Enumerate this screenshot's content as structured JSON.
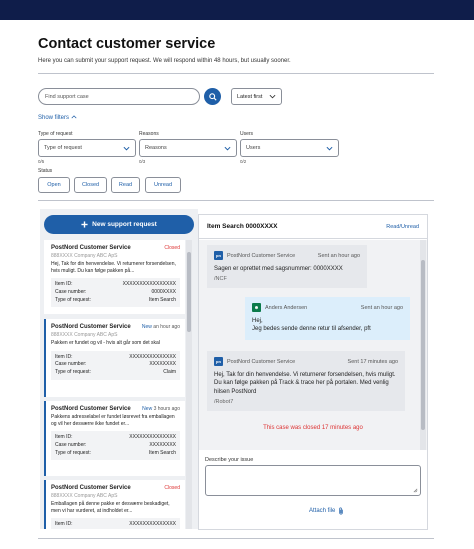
{
  "header": {
    "title": "Contact customer service",
    "subtitle": "Here you can submit your support request. We will respond within 48 hours, but usually sooner."
  },
  "search": {
    "placeholder": "Find support case",
    "button_icon": "search-icon"
  },
  "sort": {
    "selected": "Latest first"
  },
  "filters": {
    "toggle_label": "Show filters",
    "type": {
      "label": "Type of request",
      "placeholder": "Type of request",
      "count": "0/5"
    },
    "reasons": {
      "label": "Reasons",
      "placeholder": "Reasons",
      "count": "0/3"
    },
    "users": {
      "label": "Users",
      "placeholder": "Users",
      "count": "0/2"
    },
    "status": {
      "label": "Status",
      "buttons": [
        "Open",
        "Closed",
        "Read",
        "Unread"
      ]
    }
  },
  "new_request_label": "New support request",
  "cases": [
    {
      "sender": "PostNord Customer Service",
      "state": "Closed",
      "state_kind": "closed",
      "company": "888XXXX Company ABC ApS",
      "message": "Hej, Tak for din henvendelse. Vi returnerer forsendelsen, hvis muligt. Du kan følge pakken på...",
      "meta": [
        {
          "k": "Item ID:",
          "v": "XXXXXXXXXXXXXXXX"
        },
        {
          "k": "Case number:",
          "v": "0000XXXX"
        },
        {
          "k": "Type of request:",
          "v": "Item Search"
        }
      ]
    },
    {
      "sender": "PostNord Customer Service",
      "state": "New",
      "time": "an hour ago",
      "state_kind": "new",
      "company": "888XXXX Company ABC ApS",
      "message": "Pakken er fundet og vil - hvis alt går som det skal",
      "meta": [
        {
          "k": "Item ID:",
          "v": "XXXXXXXXXXXXXX"
        },
        {
          "k": "Case number:",
          "v": "XXXXXXXX"
        },
        {
          "k": "Type of request:",
          "v": "Claim"
        }
      ]
    },
    {
      "sender": "PostNord Customer Service",
      "state": "New",
      "time": "3 hours ago",
      "state_kind": "new",
      "company": "888XXXX Company ABC ApS",
      "message": "Pakkens adresselabel er fundet løsrevet fra emballagen og vil her desværre ikke fundet er...",
      "meta": [
        {
          "k": "Item ID:",
          "v": "XXXXXXXXXXXXXX"
        },
        {
          "k": "Case number:",
          "v": "XXXXXXXX"
        },
        {
          "k": "Type of request:",
          "v": "Item Search"
        }
      ]
    },
    {
      "sender": "PostNord Customer Service",
      "state": "Closed",
      "state_kind": "closed",
      "company": "888XXXX Company ABC ApS",
      "message": "Emballagen på denne pakke er desværre beskadiget, men vi har vurderet, at indholdet er...",
      "meta": [
        {
          "k": "Item ID:",
          "v": "XXXXXXXXXXXXXX"
        }
      ]
    }
  ],
  "detail": {
    "title": "Item Search  0000XXXX",
    "read_unread": "Read/Unread",
    "messages": [
      {
        "from": "PostNord Customer Service",
        "time": "Sent an hour ago",
        "text": "Sagen er oprettet med sagsnummer: 0000XXXX",
        "ref": "/NCF",
        "mine": false
      },
      {
        "from": "Anders Andersen",
        "time": "Sent an hour ago",
        "text": "Hej,\nJeg bedes sende denne retur til afsender, pft",
        "ref": "",
        "mine": true
      },
      {
        "from": "PostNord Customer Service",
        "time": "Sent 17 minutes ago",
        "text": "Hej, Tak for din henvendelse. Vi returnerer forsendelsen, hvis muligt. Du kan følge pakken på Track & trace her på portalen. Med venlig hilsen PostNord",
        "ref": "/Robot7",
        "mine": false
      }
    ],
    "closed_note": "This case was closed 17 minutes ago",
    "describe_label": "Describe your issue",
    "attach_label": "Attach file"
  }
}
